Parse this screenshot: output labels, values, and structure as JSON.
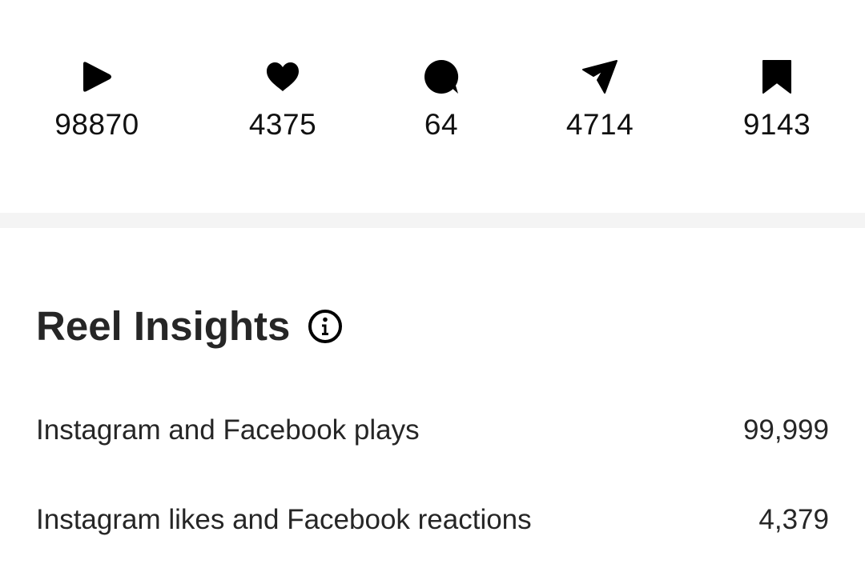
{
  "stats": [
    {
      "icon": "play-icon",
      "count": "98870"
    },
    {
      "icon": "heart-icon",
      "count": "4375"
    },
    {
      "icon": "comment-icon",
      "count": "64"
    },
    {
      "icon": "share-icon",
      "count": "4714"
    },
    {
      "icon": "bookmark-icon",
      "count": "9143"
    }
  ],
  "insights": {
    "title": "Reel Insights",
    "info_icon": "info-icon",
    "metrics": [
      {
        "label": "Instagram and Facebook plays",
        "value": "99,999"
      },
      {
        "label": "Instagram likes and Facebook reactions",
        "value": "4,379"
      }
    ]
  },
  "colors": {
    "text": "#262626",
    "icon": "#000000",
    "divider": "#f4f4f4",
    "background": "#ffffff"
  }
}
